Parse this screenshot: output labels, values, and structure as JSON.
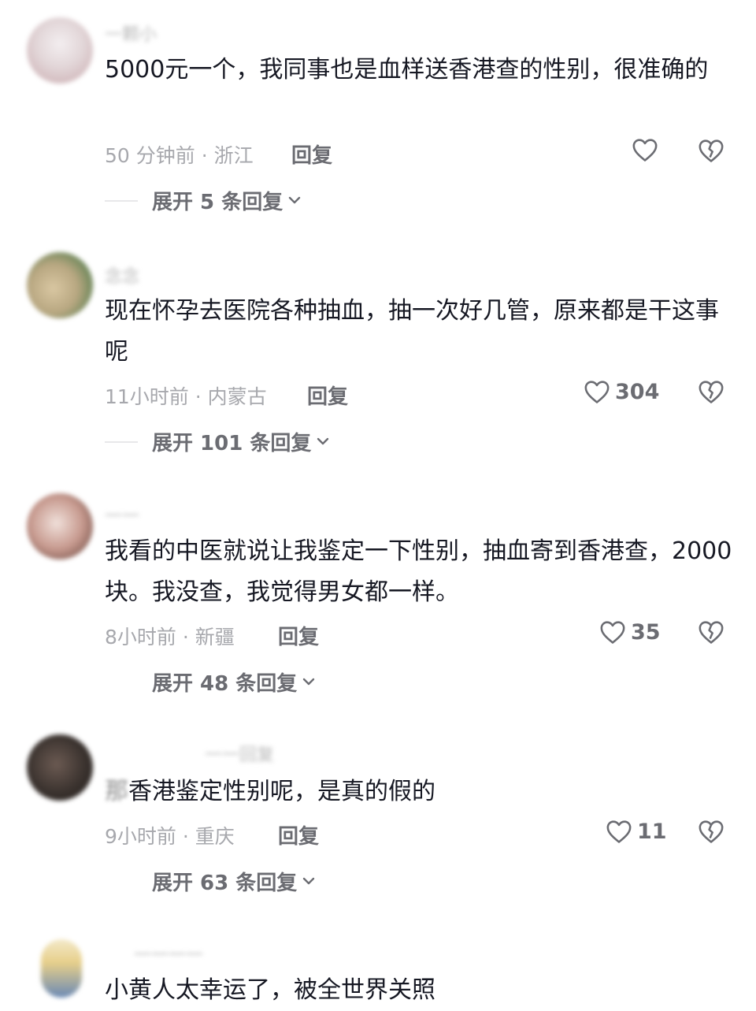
{
  "comments": [
    {
      "username": "一颗小",
      "text": "5000元一个，我同事也是血样送香港查的性别，很准确的",
      "time_location": "50 分钟前 · 浙江",
      "reply_label": "回复",
      "likes": "",
      "expand_label": "展开 5 条回复",
      "avatar_colors": [
        "#e9e4e6",
        "#c9a1a4"
      ]
    },
    {
      "username": "念念",
      "text": "现在怀孕去医院各种抽血，抽一次好几管，原来都是干这事呢",
      "time_location": "11小时前 · 内蒙古",
      "reply_label": "回复",
      "likes": "304",
      "expand_label": "展开 101 条回复",
      "avatar_colors": [
        "#c7b58a",
        "#3e7a45"
      ]
    },
    {
      "username": "一一",
      "text": "我看的中医就说让我鉴定一下性别，抽血寄到香港查，2000块。我没查，我觉得男女都一样。",
      "time_location": "8小时前 · 新疆",
      "reply_label": "回复",
      "likes": "35",
      "expand_label": "展开 48 条回复",
      "avatar_colors": [
        "#e8d3cd",
        "#6e4c45"
      ]
    },
    {
      "username": "一一回复",
      "text_prefix": "那",
      "text": "香港鉴定性别呢，是真的假的",
      "time_location": "9小时前 · 重庆",
      "reply_label": "回复",
      "likes": "11",
      "expand_label": "展开 63 条回复",
      "avatar_colors": [
        "#4a3f3b",
        "#2a2523"
      ]
    },
    {
      "username": "一一一一",
      "text": "小黄人太幸运了，被全世界关照",
      "avatar_colors": [
        "#f0e6c8",
        "#6a89b5"
      ]
    }
  ],
  "icons": {
    "like": "heart-outline-icon",
    "dislike": "broken-heart-icon",
    "expand": "chevron-down-icon"
  },
  "colors": {
    "text": "#161823",
    "meta": "#a7a8ad",
    "action": "#6b6c72"
  }
}
